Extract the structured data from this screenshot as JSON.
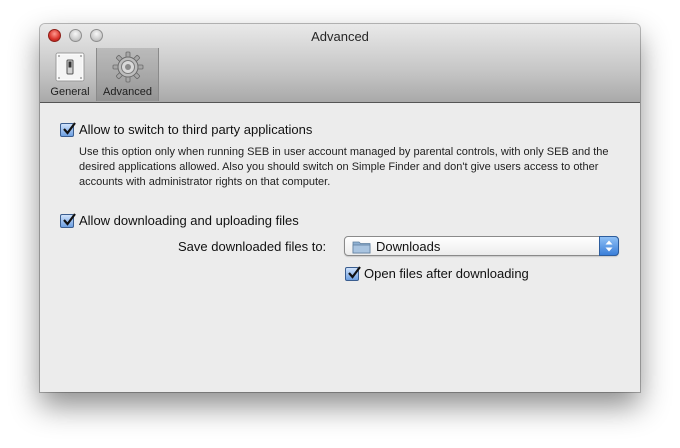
{
  "window": {
    "title": "Advanced"
  },
  "toolbar": {
    "tabs": [
      {
        "label": "General",
        "icon": "switch-icon",
        "selected": false
      },
      {
        "label": "Advanced",
        "icon": "gear-icon",
        "selected": true
      }
    ]
  },
  "options": {
    "third_party": {
      "label": "Allow to switch to third party applications",
      "checked": true,
      "description": "Use this option only when running SEB in user account managed by parental controls, with only SEB and the desired applications allowed. Also you should switch on Simple Finder and don't give users access to other accounts with administrator rights on that computer."
    },
    "downloads": {
      "label": "Allow downloading and uploading files",
      "checked": true
    },
    "save_to": {
      "label": "Save downloaded files to:",
      "value": "Downloads",
      "icon": "folder-icon"
    },
    "open_after": {
      "label": "Open files after downloading",
      "checked": true
    }
  }
}
